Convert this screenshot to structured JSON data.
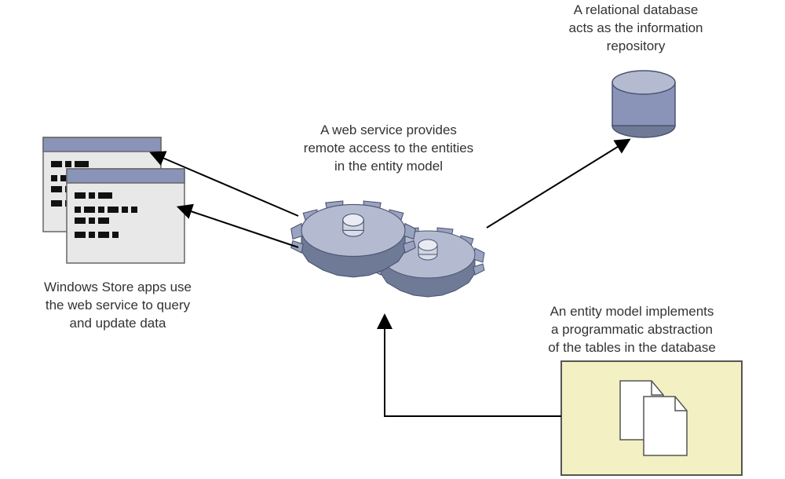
{
  "labels": {
    "database": "A relational database\nacts as the information\nrepository",
    "web_service": "A web service provides\nremote access to the entities\nin the entity model",
    "apps": "Windows Store apps use\nthe web service to query\nand update data",
    "entity_model": "An entity model implements\na programmatic abstraction\nof the tables in the database"
  }
}
